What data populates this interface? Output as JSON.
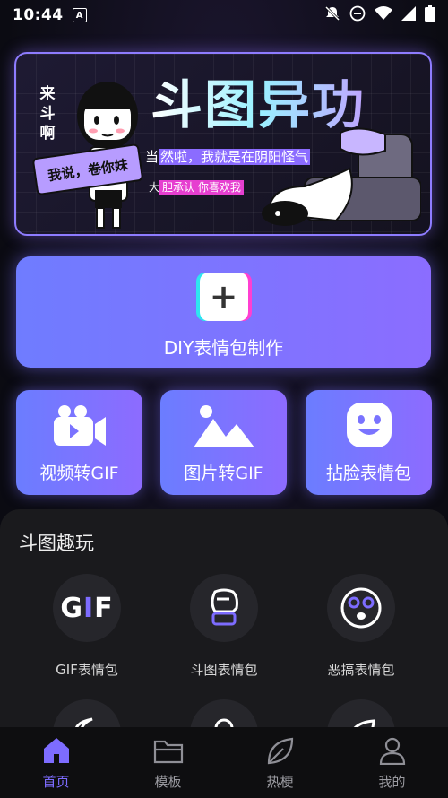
{
  "status": {
    "time": "10:44",
    "badge": "A"
  },
  "banner": {
    "title": "斗图异功",
    "vertical_text": "来斗啊",
    "scroll_text": "我说，卷你妹",
    "line1_prefix": "当",
    "line1_highlight": "然啦，我就是在阴阳怪气",
    "line2_prefix": "大",
    "line2_highlight": "胆承认 你喜欢我"
  },
  "diy": {
    "label": "DIY表情包制作"
  },
  "cards": [
    {
      "label": "视频转GIF",
      "icon": "video-camera-icon"
    },
    {
      "label": "图片转GIF",
      "icon": "image-mountain-icon"
    },
    {
      "label": "拈脸表情包",
      "icon": "smiley-face-icon"
    }
  ],
  "fun": {
    "title": "斗图趣玩",
    "gif_logo_prefix": "G",
    "gif_logo_i": "I",
    "gif_logo_suffix": "F",
    "items": [
      {
        "label": "GIF表情包",
        "icon": "gif-icon"
      },
      {
        "label": "斗图表情包",
        "icon": "fist-icon"
      },
      {
        "label": "恶搞表情包",
        "icon": "silly-face-icon"
      }
    ]
  },
  "nav": {
    "tabs": [
      {
        "label": "首页",
        "icon": "home-icon",
        "active": true
      },
      {
        "label": "模板",
        "icon": "folder-icon",
        "active": false
      },
      {
        "label": "热梗",
        "icon": "leaf-icon",
        "active": false
      },
      {
        "label": "我的",
        "icon": "person-icon",
        "active": false
      }
    ]
  },
  "colors": {
    "accent": "#7d6cff",
    "card_start": "#6b7dff",
    "card_end": "#8d6bff",
    "cyan": "#2ee6f0",
    "magenta": "#ff3fd1"
  }
}
